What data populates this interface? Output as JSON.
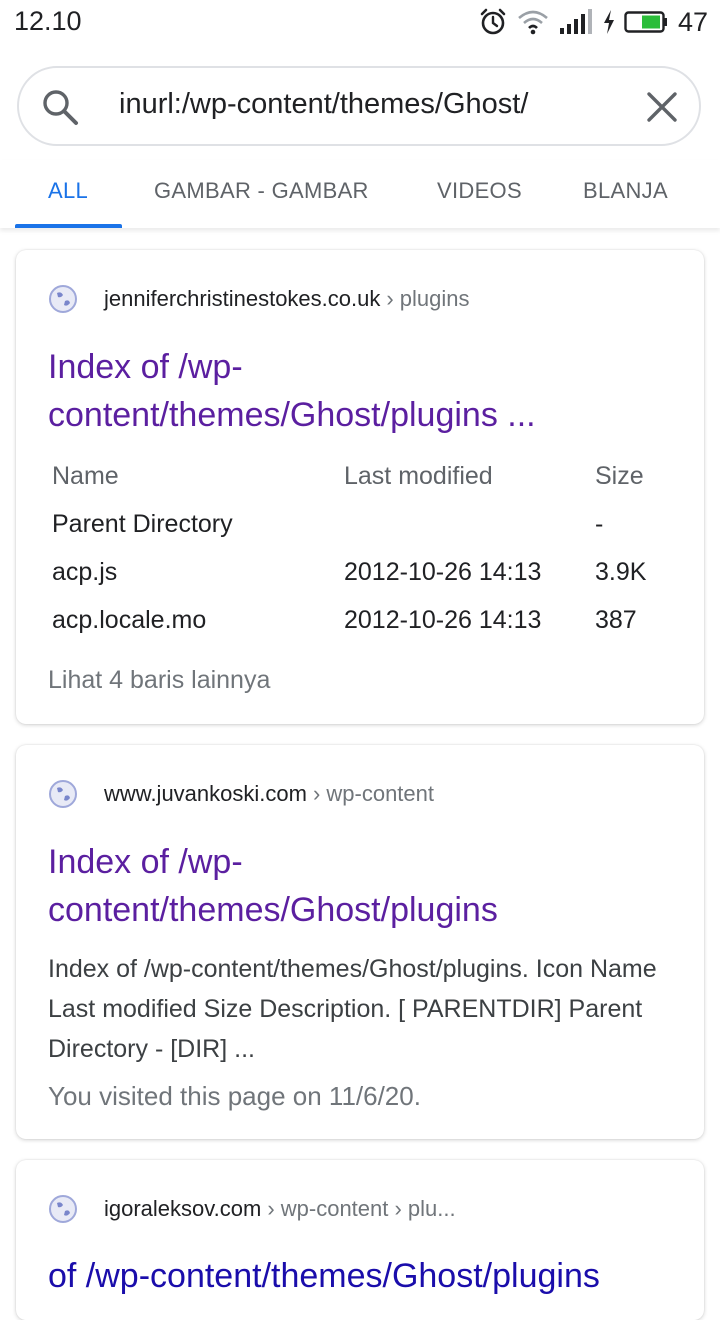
{
  "status_bar": {
    "time": "12.10",
    "battery": "47",
    "icons": [
      "alarm-icon",
      "wifi-icon",
      "signal-icon",
      "charging-icon",
      "battery-icon"
    ]
  },
  "search": {
    "query": "inurl:/wp-content/themes/Ghost/",
    "icon": "search-icon",
    "clear_icon": "close-icon"
  },
  "tabs": [
    {
      "label": "ALL",
      "active": true
    },
    {
      "label": "GAMBAR - GAMBAR",
      "active": false
    },
    {
      "label": "VIDEOS",
      "active": false
    },
    {
      "label": "BLANJA",
      "active": false
    }
  ],
  "results": [
    {
      "domain": "jenniferchristinestokes.co.uk",
      "path": "› plugins",
      "title_line1": "Index of /wp-",
      "title_line2": "content/themes/Ghost/plugins ...",
      "table": {
        "headers": [
          "Name",
          "Last modified",
          "Size"
        ],
        "rows": [
          [
            "Parent Directory",
            "",
            "-"
          ],
          [
            "acp.js",
            "2012-10-26 14:13",
            "3.9K"
          ],
          [
            "acp.locale.mo",
            "2012-10-26 14:13",
            "387"
          ]
        ]
      },
      "more": "Lihat 4 baris lainnya"
    },
    {
      "domain": "www.juvankoski.com",
      "path": "› wp-content",
      "title_line1": "Index of /wp-",
      "title_line2": "content/themes/Ghost/plugins",
      "snippet": "Index of /wp-content/themes/Ghost/plugins. Icon Name Last modified Size Description. [ PARENTDIR] Parent Directory - [DIR] ...",
      "visited": "You visited this page on 11/6/20."
    },
    {
      "domain": "igoraleksov.com",
      "path": "› wp-content › plu...",
      "title_line1": "of /wp-content/themes/Ghost/plugins"
    }
  ],
  "colors": {
    "accent": "#1a73e8",
    "visited_link": "#5b1fa0",
    "link": "#1a0dab",
    "muted": "#70757a"
  }
}
